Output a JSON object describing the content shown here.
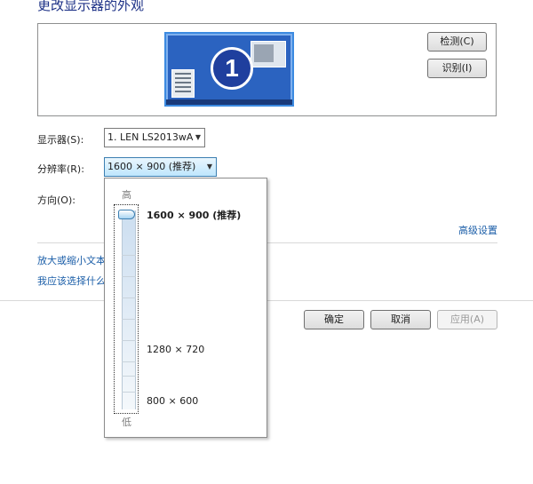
{
  "page": {
    "title": "更改显示器的外观"
  },
  "preview": {
    "monitor_number": "1"
  },
  "buttons": {
    "detect": "检测(C)",
    "identify": "识别(I)",
    "ok": "确定",
    "cancel": "取消",
    "apply": "应用(A)"
  },
  "display": {
    "label": "显示器(S):",
    "value": "1. LEN LS2013wA"
  },
  "resolution": {
    "label": "分辨率(R):",
    "value": "1600 × 900 (推荐)",
    "slider_high": "高",
    "slider_low": "低",
    "slider_position_fraction": 1.0,
    "options": [
      "1600 × 900 (推荐)",
      "1280 × 720",
      "800 × 600"
    ]
  },
  "orientation": {
    "label": "方向(O):"
  },
  "links": {
    "advanced": "高级设置",
    "enlarge_text": "放大或缩小文本",
    "which_settings": "我应该选择什么"
  }
}
